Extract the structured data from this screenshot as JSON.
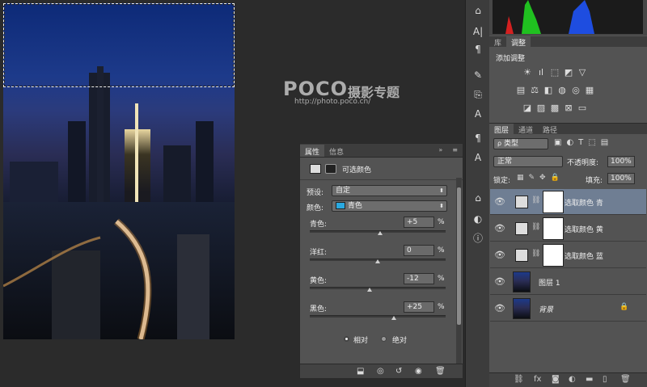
{
  "watermark": {
    "brand": "POCO",
    "tagline": "摄影专题",
    "url": "http://photo.poco.cn/"
  },
  "properties": {
    "tabs": [
      "属性",
      "信息"
    ],
    "header_title": "可选颜色",
    "preset_label": "预设:",
    "preset_value": "自定",
    "color_label": "颜色:",
    "color_value": "青色",
    "color_swatch": "#2aa9e0",
    "sliders": [
      {
        "label": "青色:",
        "value": "+5",
        "unit": "%",
        "pos": 0.52
      },
      {
        "label": "洋红:",
        "value": "0",
        "unit": "%",
        "pos": 0.5
      },
      {
        "label": "黄色:",
        "value": "-12",
        "unit": "%",
        "pos": 0.44
      },
      {
        "label": "黑色:",
        "value": "+25",
        "unit": "%",
        "pos": 0.62
      }
    ],
    "method_relative": "相对",
    "method_absolute": "绝对",
    "method_selected": "relative"
  },
  "toolstrip": {
    "icons": [
      "stamp-icon",
      "character-icon",
      "paragraph-icon",
      "brush-icon",
      "clone-source-icon",
      "text-style-icon",
      "paragraph-style-icon",
      "type-icon",
      "tool-presets-icon",
      "adjust-icon",
      "info-icon"
    ]
  },
  "adjustments_panel": {
    "tabs": [
      "库",
      "调整"
    ],
    "title": "添加调整"
  },
  "layers_panel": {
    "tabs": [
      "图层",
      "通道",
      "路径"
    ],
    "filter_label": "类型",
    "blend_mode": "正常",
    "opacity_label": "不透明度:",
    "opacity": "100%",
    "lock_label": "锁定:",
    "fill_label": "填充:",
    "fill": "100%",
    "layers": [
      {
        "name": "选取颜色 青",
        "type": "adjustment",
        "active": true
      },
      {
        "name": "选取颜色 黄",
        "type": "adjustment",
        "active": false
      },
      {
        "name": "选取颜色 蓝",
        "type": "adjustment",
        "active": false
      },
      {
        "name": "图层 1",
        "type": "image",
        "active": false
      },
      {
        "name": "背景",
        "type": "image",
        "active": false,
        "locked": true
      }
    ]
  }
}
